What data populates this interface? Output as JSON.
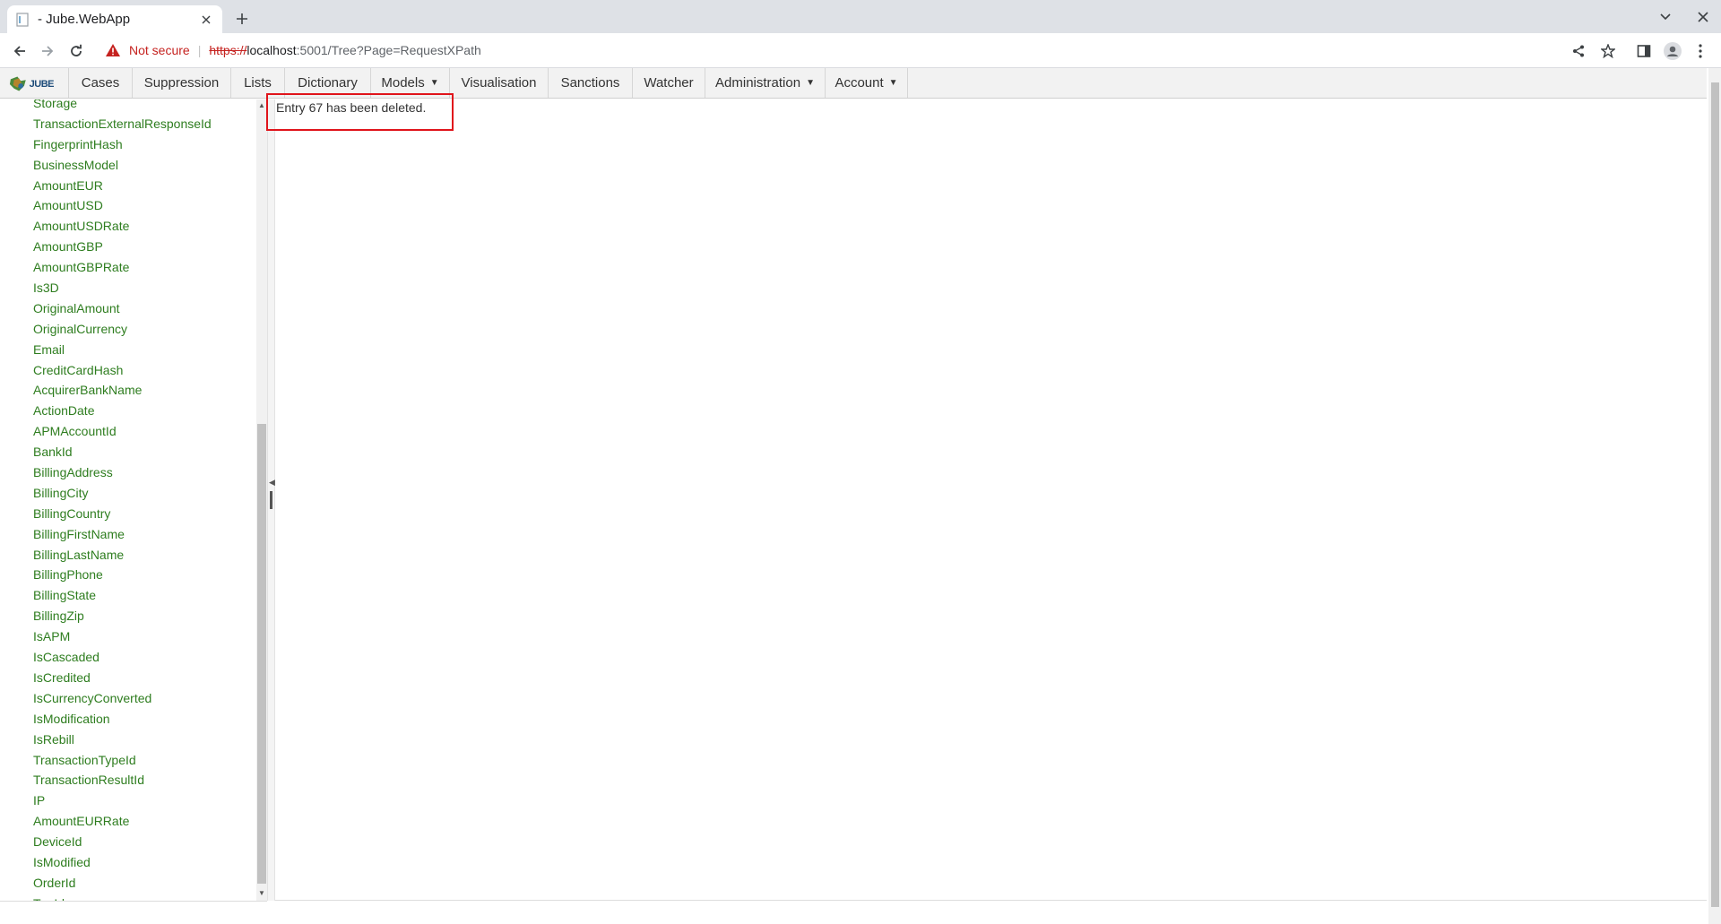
{
  "browser": {
    "tab_title": "- Jube.WebApp",
    "security_label": "Not secure",
    "url_scheme": "https://",
    "url_host": "localhost",
    "url_rest": ":5001/Tree?Page=RequestXPath"
  },
  "nav": {
    "logo_text": "JUBE",
    "items": [
      {
        "label": "Cases"
      },
      {
        "label": "Suppression"
      },
      {
        "label": "Lists"
      },
      {
        "label": "Dictionary"
      },
      {
        "label": "Models"
      },
      {
        "label": "Visualisation"
      },
      {
        "label": "Sanctions"
      },
      {
        "label": "Watcher"
      },
      {
        "label": "Administration"
      },
      {
        "label": "Account"
      }
    ]
  },
  "tree": {
    "items": [
      "Storage",
      "TransactionExternalResponseId",
      "FingerprintHash",
      "BusinessModel",
      "AmountEUR",
      "AmountUSD",
      "AmountUSDRate",
      "AmountGBP",
      "AmountGBPRate",
      "Is3D",
      "OriginalAmount",
      "OriginalCurrency",
      "Email",
      "CreditCardHash",
      "AcquirerBankName",
      "ActionDate",
      "APMAccountId",
      "BankId",
      "BillingAddress",
      "BillingCity",
      "BillingCountry",
      "BillingFirstName",
      "BillingLastName",
      "BillingPhone",
      "BillingState",
      "BillingZip",
      "IsAPM",
      "IsCascaded",
      "IsCredited",
      "IsCurrencyConverted",
      "IsModification",
      "IsRebill",
      "TransactionTypeId",
      "TransactionResultId",
      "IP",
      "AmountEURRate",
      "DeviceId",
      "IsModified",
      "OrderId",
      "TxnId"
    ]
  },
  "content": {
    "message": "Entry 67 has been deleted."
  },
  "colors": {
    "tree_link": "#2e7d1f",
    "highlight_border": "#e0141b",
    "not_secure": "#c5221f"
  }
}
